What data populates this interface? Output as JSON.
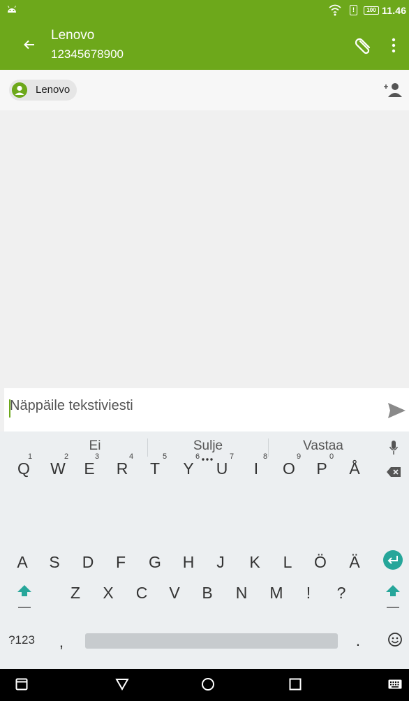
{
  "status_bar": {
    "battery": "100",
    "time": "11.46"
  },
  "app_bar": {
    "title": "Lenovo",
    "subtitle": "12345678900"
  },
  "recipients": {
    "chip_label": "Lenovo"
  },
  "compose": {
    "placeholder": "Näppäile tekstiviesti"
  },
  "keyboard": {
    "suggestions": [
      "Ei",
      "Sulje",
      "Vastaa"
    ],
    "row1": [
      {
        "key": "Q",
        "hint": "1"
      },
      {
        "key": "W",
        "hint": "2"
      },
      {
        "key": "E",
        "hint": "3"
      },
      {
        "key": "R",
        "hint": "4"
      },
      {
        "key": "T",
        "hint": "5"
      },
      {
        "key": "Y",
        "hint": "6"
      },
      {
        "key": "U",
        "hint": "7"
      },
      {
        "key": "I",
        "hint": "8"
      },
      {
        "key": "O",
        "hint": "9"
      },
      {
        "key": "P",
        "hint": "0"
      },
      {
        "key": "Å",
        "hint": ""
      }
    ],
    "row2": [
      "A",
      "S",
      "D",
      "F",
      "G",
      "H",
      "J",
      "K",
      "L",
      "Ö",
      "Ä"
    ],
    "row3": [
      "Z",
      "X",
      "C",
      "V",
      "B",
      "N",
      "M",
      "!",
      "?"
    ],
    "row4": {
      "symbols_key": "?123",
      "comma_key": ",",
      "period_key": "."
    },
    "accent_color": "#26a69a"
  },
  "icons": {
    "status": [
      "android-icon",
      "wifi-icon",
      "sim-icon",
      "battery-icon"
    ],
    "app_bar": [
      "back-arrow-icon",
      "paperclip-icon",
      "more-vert-icon"
    ],
    "recipients": [
      "person-avatar-icon",
      "add-contact-icon"
    ],
    "compose": [
      "send-icon"
    ],
    "keyboard": [
      "mic-icon",
      "backspace-icon",
      "enter-icon",
      "shift-icon",
      "emoji-icon"
    ],
    "nav": [
      "recents-icon",
      "back-triangle-icon",
      "home-circle-icon",
      "overview-square-icon",
      "keyboard-icon"
    ]
  },
  "colors": {
    "brand_green": "#6da81b",
    "nav_black": "#000000"
  }
}
